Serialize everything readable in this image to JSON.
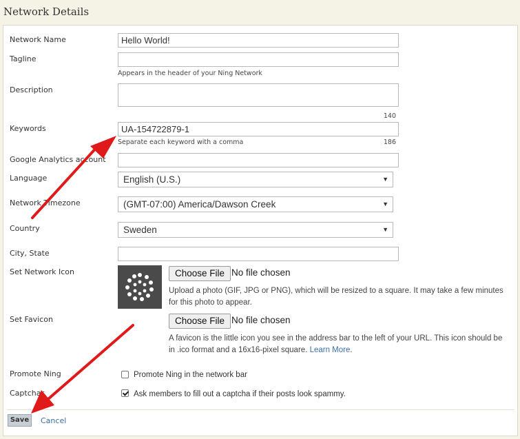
{
  "page": {
    "title": "Network Details"
  },
  "form": {
    "network_name": {
      "label": "Network Name",
      "value": "Hello World!"
    },
    "tagline": {
      "label": "Tagline",
      "value": "",
      "hint": "Appears in the header of your Ning Network"
    },
    "description": {
      "label": "Description",
      "value": "",
      "counter": "140"
    },
    "keywords": {
      "label": "Keywords",
      "value": "UA-154722879-1",
      "hint": "Separate each keyword with a comma",
      "counter": "186"
    },
    "google_analytics": {
      "label": "Google Analytics account",
      "value": ""
    },
    "language": {
      "label": "Language",
      "selected": "English (U.S.)"
    },
    "timezone": {
      "label": "Network Timezone",
      "selected": "(GMT-07:00) America/Dawson Creek"
    },
    "country": {
      "label": "Country",
      "selected": "Sweden"
    },
    "city_state": {
      "label": "City, State",
      "value": ""
    },
    "network_icon": {
      "label": "Set Network Icon",
      "choose_label": "Choose File",
      "file_status": "No file chosen",
      "description": "Upload a photo (GIF, JPG or PNG), which will be resized to a square. It may take a few minutes for this photo to appear."
    },
    "favicon": {
      "label": "Set Favicon",
      "choose_label": "Choose File",
      "file_status": "No file chosen",
      "description": "A favicon is the little icon you see in the address bar to the left of your URL. This icon should be in .ico format and a 16x16-pixel square.",
      "link": "Learn More",
      "link_suffix": "."
    },
    "promote": {
      "label": "Promote Ning",
      "checkbox_label": "Promote Ning in the network bar",
      "checked": false
    },
    "captcha": {
      "label": "Captchas",
      "checkbox_label": "Ask members to fill out a captcha if their posts look spammy.",
      "checked": true
    }
  },
  "actions": {
    "save": "Save",
    "cancel": "Cancel"
  },
  "icons": {
    "network_icon": "dot-ring-icon",
    "arrow_color": "#e01a1a"
  }
}
